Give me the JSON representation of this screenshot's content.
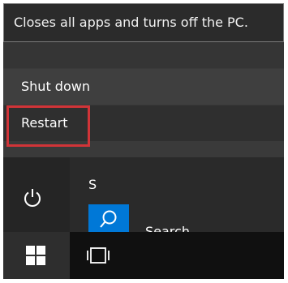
{
  "tooltip": {
    "text": "Closes all apps and turns off the PC."
  },
  "power_menu": {
    "items": [
      {
        "label": "Shut down"
      },
      {
        "label": "Restart",
        "highlighted": true
      }
    ]
  },
  "start_menu": {
    "section_letter": "S",
    "apps": [
      {
        "label": "Search",
        "icon": "search-icon",
        "tile_color": "#0078d7"
      }
    ]
  },
  "icons": {
    "power": "power-icon",
    "start": "windows-logo-icon",
    "task_view": "task-view-icon"
  },
  "colors": {
    "highlight_border": "#d13438",
    "accent": "#0078d7"
  }
}
